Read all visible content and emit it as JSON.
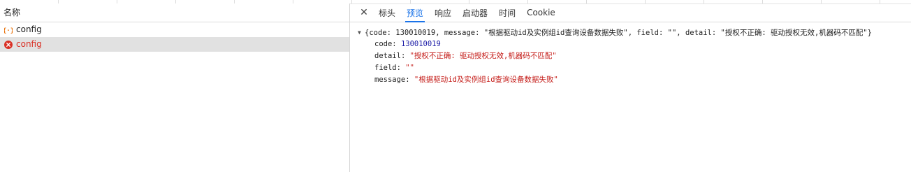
{
  "request_list": {
    "header": "名称",
    "items": [
      {
        "name": "config",
        "status": "pending",
        "icon": "curly-brace-icon"
      },
      {
        "name": "config",
        "status": "error",
        "icon": "error-icon"
      }
    ]
  },
  "details": {
    "tabs": [
      "标头",
      "预览",
      "响应",
      "启动器",
      "时间",
      "Cookie"
    ],
    "active_tab": "预览",
    "summary": {
      "open": "{",
      "code_key": "code",
      "code_val": "130010019",
      "message_key": "message",
      "message_val": "\"根据驱动id及实例组id查询设备数据失败\"",
      "field_key": "field",
      "field_val": "\"\"",
      "detail_key": "detail",
      "detail_val": "\"授权不正确: 驱动授权无效,机器码不匹配\"",
      "close": "}"
    },
    "props": [
      {
        "key": "code",
        "value": "130010019",
        "type": "number"
      },
      {
        "key": "detail",
        "value": "\"授权不正确: 驱动授权无效,机器码不匹配\"",
        "type": "string"
      },
      {
        "key": "field",
        "value": "\"\"",
        "type": "string"
      },
      {
        "key": "message",
        "value": "\"根据驱动id及实例组id查询设备数据失败\"",
        "type": "string"
      }
    ]
  },
  "colors": {
    "accent": "#1a73e8",
    "error": "#d93025",
    "string": "#c41a16",
    "number": "#1a1aa6",
    "pending_icon": "#e8710a"
  }
}
